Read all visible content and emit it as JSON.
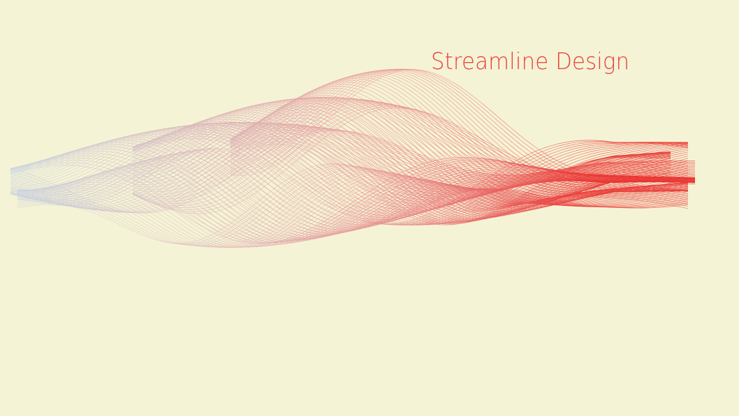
{
  "title": "Streamline Design",
  "colors": {
    "background": "#F5F3D5",
    "title": "#E8413A",
    "line_start": "#C9D3E0",
    "line_end": "#EA3431"
  }
}
